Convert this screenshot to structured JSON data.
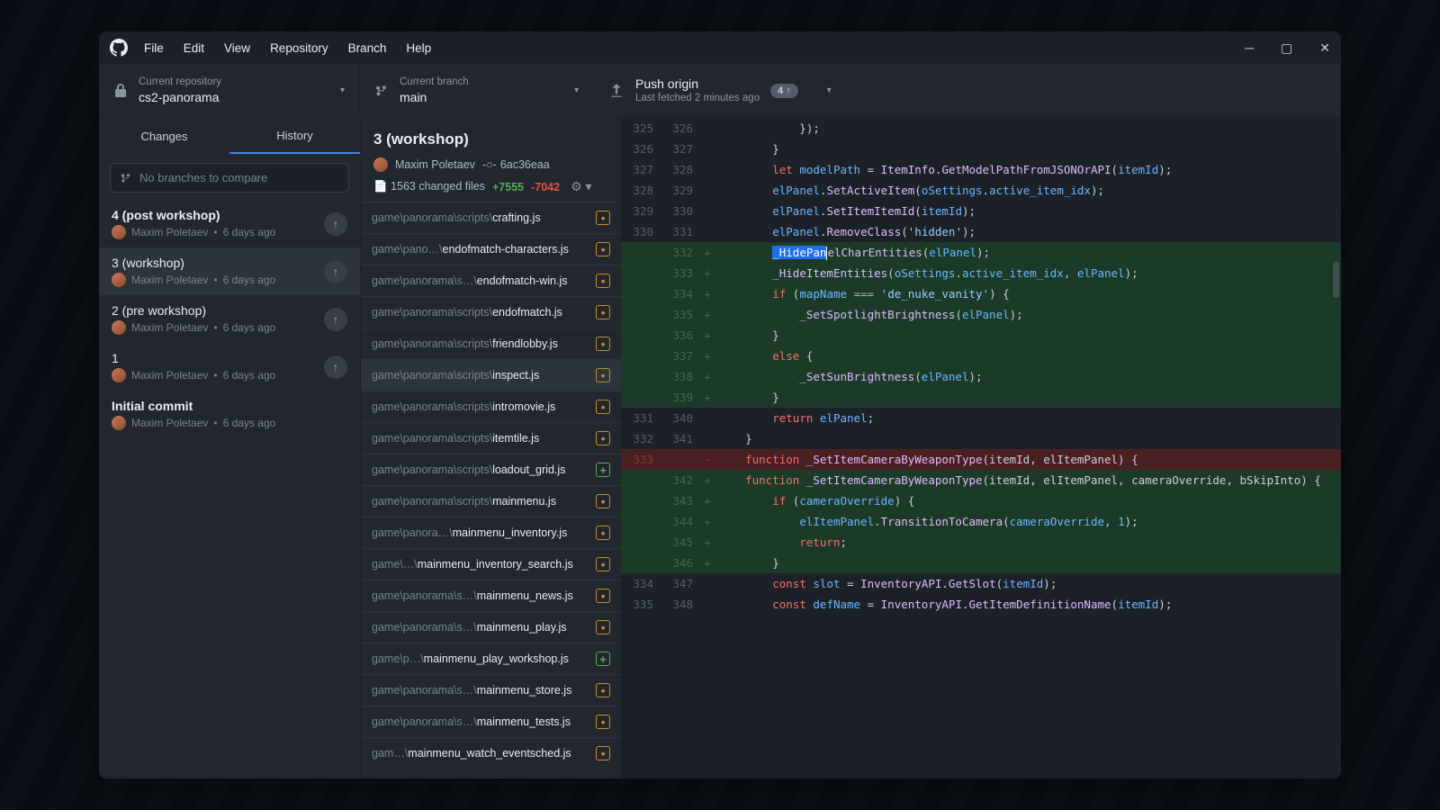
{
  "menu": {
    "file": "File",
    "edit": "Edit",
    "view": "View",
    "repository": "Repository",
    "branch": "Branch",
    "help": "Help"
  },
  "toolbar": {
    "repo_label": "Current repository",
    "repo_name": "cs2-panorama",
    "branch_label": "Current branch",
    "branch_name": "main",
    "push_title": "Push origin",
    "push_sub": "Last fetched 2 minutes ago",
    "push_count": "4"
  },
  "tabs": {
    "changes": "Changes",
    "history": "History"
  },
  "compare_placeholder": "No branches to compare",
  "commits": [
    {
      "title": "4 (post workshop)",
      "author": "Maxim Poletaev",
      "when": "6 days ago",
      "push": true,
      "bold": true
    },
    {
      "title": "3 (workshop)",
      "author": "Maxim Poletaev",
      "when": "6 days ago",
      "push": true,
      "selected": true
    },
    {
      "title": "2 (pre workshop)",
      "author": "Maxim Poletaev",
      "when": "6 days ago",
      "push": true
    },
    {
      "title": "1",
      "author": "Maxim Poletaev",
      "when": "6 days ago",
      "push": true
    },
    {
      "title": "Initial commit",
      "author": "Maxim Poletaev",
      "when": "6 days ago",
      "push": false,
      "bold": true
    }
  ],
  "header": {
    "title": "3 (workshop)",
    "author": "Maxim Poletaev",
    "sha": "6ac36eaa",
    "files_changed": "1563 changed files",
    "additions": "+7555",
    "deletions": "-7042"
  },
  "files": [
    {
      "dir": "game\\panorama\\scripts\\",
      "name": "crafting.js",
      "status": "mod"
    },
    {
      "dir": "game\\pano…\\",
      "name": "endofmatch-characters.js",
      "status": "mod"
    },
    {
      "dir": "game\\panorama\\s…\\",
      "name": "endofmatch-win.js",
      "status": "mod"
    },
    {
      "dir": "game\\panorama\\scripts\\",
      "name": "endofmatch.js",
      "status": "mod"
    },
    {
      "dir": "game\\panorama\\scripts\\",
      "name": "friendlobby.js",
      "status": "mod"
    },
    {
      "dir": "game\\panorama\\scripts\\",
      "name": "inspect.js",
      "status": "mod",
      "selected": true
    },
    {
      "dir": "game\\panorama\\scripts\\",
      "name": "intromovie.js",
      "status": "mod"
    },
    {
      "dir": "game\\panorama\\scripts\\",
      "name": "itemtile.js",
      "status": "mod"
    },
    {
      "dir": "game\\panorama\\scripts\\",
      "name": "loadout_grid.js",
      "status": "add"
    },
    {
      "dir": "game\\panorama\\scripts\\",
      "name": "mainmenu.js",
      "status": "mod"
    },
    {
      "dir": "game\\panora…\\",
      "name": "mainmenu_inventory.js",
      "status": "mod"
    },
    {
      "dir": "game\\…\\",
      "name": "mainmenu_inventory_search.js",
      "status": "mod"
    },
    {
      "dir": "game\\panorama\\s…\\",
      "name": "mainmenu_news.js",
      "status": "mod"
    },
    {
      "dir": "game\\panorama\\s…\\",
      "name": "mainmenu_play.js",
      "status": "mod"
    },
    {
      "dir": "game\\p…\\",
      "name": "mainmenu_play_workshop.js",
      "status": "add"
    },
    {
      "dir": "game\\panorama\\s…\\",
      "name": "mainmenu_store.js",
      "status": "mod"
    },
    {
      "dir": "game\\panorama\\s…\\",
      "name": "mainmenu_tests.js",
      "status": "mod"
    },
    {
      "dir": "gam…\\",
      "name": "mainmenu_watch_eventsched.js",
      "status": "mod"
    }
  ],
  "diff": [
    {
      "old": "325",
      "new": "326",
      "t": "ctx",
      "html": "            });"
    },
    {
      "old": "326",
      "new": "327",
      "t": "ctx",
      "html": "        }"
    },
    {
      "old": "327",
      "new": "328",
      "t": "ctx",
      "html": "        <span class='kw'>let</span> <span class='var'>modelPath</span> = <span class='fn'>ItemInfo</span>.<span class='fn'>GetModelPathFromJSONOrAPI</span>(<span class='var'>itemId</span>);"
    },
    {
      "old": "328",
      "new": "329",
      "t": "ctx",
      "html": "        <span class='var'>elPanel</span>.<span class='fn'>SetActiveItem</span>(<span class='var'>oSettings</span>.<span class='var'>active_item_idx</span>);"
    },
    {
      "old": "329",
      "new": "330",
      "t": "ctx",
      "html": "        <span class='var'>elPanel</span>.<span class='fn'>SetItemItemId</span>(<span class='var'>itemId</span>);"
    },
    {
      "old": "330",
      "new": "331",
      "t": "ctx",
      "html": "        <span class='var'>elPanel</span>.<span class='fn'>RemoveClass</span>(<span class='str'>'hidden'</span>);"
    },
    {
      "old": "",
      "new": "332",
      "t": "add",
      "html": "        <span class='sel-text'>_HidePan</span><span class='cursor-bar'></span><span class='fn'>elCharEntities</span>(<span class='var'>elPanel</span>);"
    },
    {
      "old": "",
      "new": "333",
      "t": "add",
      "html": "        <span class='fn'>_HideItemEntities</span>(<span class='var'>oSettings</span>.<span class='var'>active_item_idx</span>, <span class='var'>elPanel</span>);"
    },
    {
      "old": "",
      "new": "334",
      "t": "add",
      "html": "        <span class='kw'>if</span> (<span class='var'>mapName</span> <span class='op'>===</span> <span class='str'>'de_nuke_vanity'</span>) {"
    },
    {
      "old": "",
      "new": "335",
      "t": "add",
      "html": "            <span class='fn'>_SetSpotlightBrightness</span>(<span class='var'>elPanel</span>);"
    },
    {
      "old": "",
      "new": "336",
      "t": "add",
      "html": "        }"
    },
    {
      "old": "",
      "new": "337",
      "t": "add",
      "html": "        <span class='kw'>else</span> {"
    },
    {
      "old": "",
      "new": "338",
      "t": "add",
      "html": "            <span class='fn'>_SetSunBrightness</span>(<span class='var'>elPanel</span>);"
    },
    {
      "old": "",
      "new": "339",
      "t": "add",
      "html": "        }"
    },
    {
      "old": "331",
      "new": "340",
      "t": "ctx",
      "html": "        <span class='kw'>return</span> <span class='var'>elPanel</span>;"
    },
    {
      "old": "332",
      "new": "341",
      "t": "ctx",
      "html": "    }"
    },
    {
      "old": "333",
      "new": "",
      "t": "del",
      "html": "    <span class='kw'>function</span> <span class='fn'>_SetItemCameraByWeaponType</span>(itemId, elItemPanel) {"
    },
    {
      "old": "",
      "new": "342",
      "t": "add",
      "html": "    <span class='kw'>function</span> <span class='fn'>_SetItemCameraByWeaponType</span>(itemId, elItemPanel, cameraOverride, bSkipInto) {"
    },
    {
      "old": "",
      "new": "343",
      "t": "add",
      "html": "        <span class='kw'>if</span> (<span class='var'>cameraOverride</span>) {"
    },
    {
      "old": "",
      "new": "344",
      "t": "add",
      "html": "            <span class='var'>elItemPanel</span>.<span class='fn'>TransitionToCamera</span>(<span class='var'>cameraOverride</span>, <span class='num'>1</span>);"
    },
    {
      "old": "",
      "new": "345",
      "t": "add",
      "html": "            <span class='kw'>return</span>;"
    },
    {
      "old": "",
      "new": "346",
      "t": "add",
      "html": "        }"
    },
    {
      "old": "334",
      "new": "347",
      "t": "ctx",
      "html": "        <span class='kw'>const</span> <span class='var'>slot</span> = <span class='fn'>InventoryAPI</span>.<span class='fn'>GetSlot</span>(<span class='var'>itemId</span>);"
    },
    {
      "old": "335",
      "new": "348",
      "t": "ctx",
      "html": "        <span class='kw'>const</span> <span class='var'>defName</span> = <span class='fn'>InventoryAPI</span>.<span class='fn'>GetItemDefinitionName</span>(<span class='var'>itemId</span>);"
    }
  ]
}
